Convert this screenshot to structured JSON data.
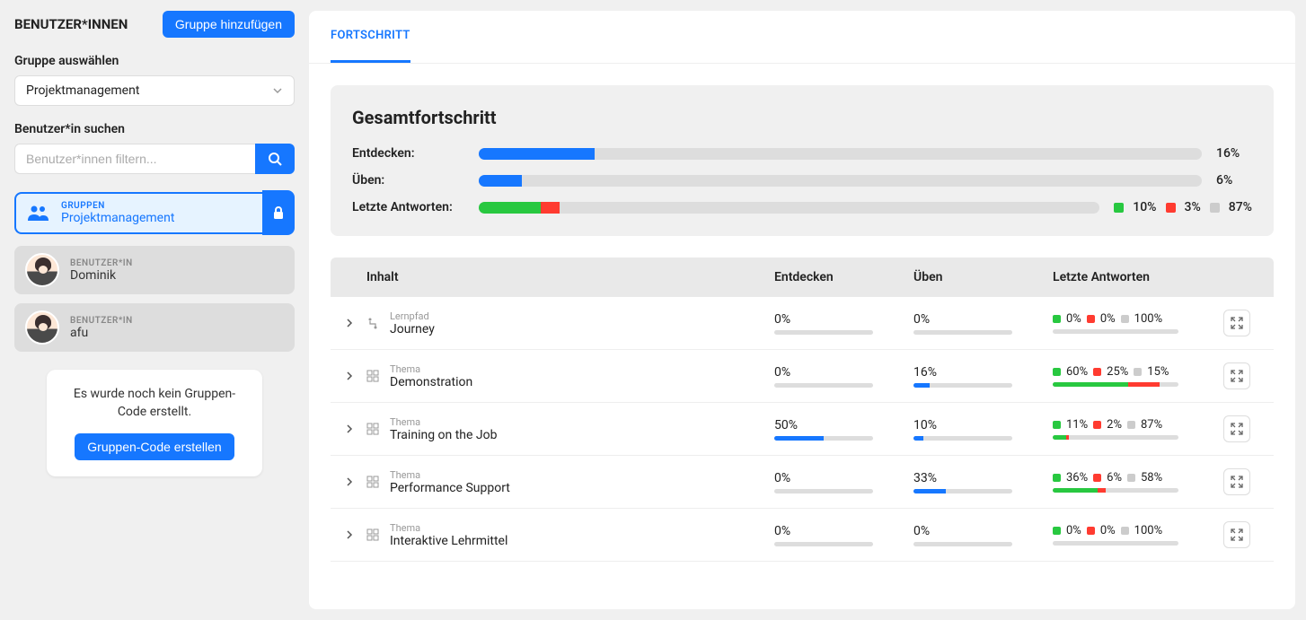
{
  "sidebar": {
    "title": "BENUTZER*INNEN",
    "add_group_btn": "Gruppe hinzufügen",
    "select_group_label": "Gruppe auswählen",
    "selected_group": "Projektmanagement",
    "search_label": "Benutzer*in suchen",
    "search_placeholder": "Benutzer*innen filtern...",
    "group_card": {
      "type": "GRUPPEN",
      "name": "Projektmanagement"
    },
    "users": [
      {
        "type": "BENUTZER*IN",
        "name": "Dominik"
      },
      {
        "type": "BENUTZER*IN",
        "name": "afu"
      }
    ],
    "code_box": {
      "text": "Es wurde noch kein Gruppen-Code erstellt.",
      "btn": "Gruppen-Code erstellen"
    }
  },
  "main": {
    "tab": "FORTSCHRITT",
    "panel_title": "Gesamtfortschritt",
    "labels": {
      "entdecken": "Entdecken:",
      "ueben": "Üben:",
      "letzte": "Letzte Antworten:"
    },
    "overall": {
      "entdecken": {
        "pct": "16%",
        "val": 16
      },
      "ueben": {
        "pct": "6%",
        "val": 6
      },
      "letzte": {
        "g": 10,
        "r": 3,
        "rest": 87,
        "g_pct": "10%",
        "r_pct": "3%",
        "rest_pct": "87%"
      }
    },
    "headers": {
      "inhalt": "Inhalt",
      "entdecken": "Entdecken",
      "ueben": "Üben",
      "letzte": "Letzte Antworten"
    },
    "rows": [
      {
        "type": "Lernpfad",
        "name": "Journey",
        "icon": "path",
        "entdecken": {
          "pct": "0%",
          "val": 0
        },
        "ueben": {
          "pct": "0%",
          "val": 0
        },
        "ant": {
          "g": 0,
          "r": 0,
          "rest": 100,
          "g_pct": "0%",
          "r_pct": "0%",
          "rest_pct": "100%"
        }
      },
      {
        "type": "Thema",
        "name": "Demonstration",
        "icon": "grid",
        "entdecken": {
          "pct": "0%",
          "val": 0
        },
        "ueben": {
          "pct": "16%",
          "val": 16
        },
        "ant": {
          "g": 60,
          "r": 25,
          "rest": 15,
          "g_pct": "60%",
          "r_pct": "25%",
          "rest_pct": "15%"
        }
      },
      {
        "type": "Thema",
        "name": "Training on the Job",
        "icon": "grid",
        "entdecken": {
          "pct": "50%",
          "val": 50
        },
        "ueben": {
          "pct": "10%",
          "val": 10
        },
        "ant": {
          "g": 11,
          "r": 2,
          "rest": 87,
          "g_pct": "11%",
          "r_pct": "2%",
          "rest_pct": "87%"
        }
      },
      {
        "type": "Thema",
        "name": "Performance Support",
        "icon": "grid",
        "entdecken": {
          "pct": "0%",
          "val": 0
        },
        "ueben": {
          "pct": "33%",
          "val": 33
        },
        "ant": {
          "g": 36,
          "r": 6,
          "rest": 58,
          "g_pct": "36%",
          "r_pct": "6%",
          "rest_pct": "58%"
        }
      },
      {
        "type": "Thema",
        "name": "Interaktive Lehrmittel",
        "icon": "grid",
        "entdecken": {
          "pct": "0%",
          "val": 0
        },
        "ueben": {
          "pct": "0%",
          "val": 0
        },
        "ant": {
          "g": 0,
          "r": 0,
          "rest": 100,
          "g_pct": "0%",
          "r_pct": "0%",
          "rest_pct": "100%"
        }
      }
    ]
  }
}
